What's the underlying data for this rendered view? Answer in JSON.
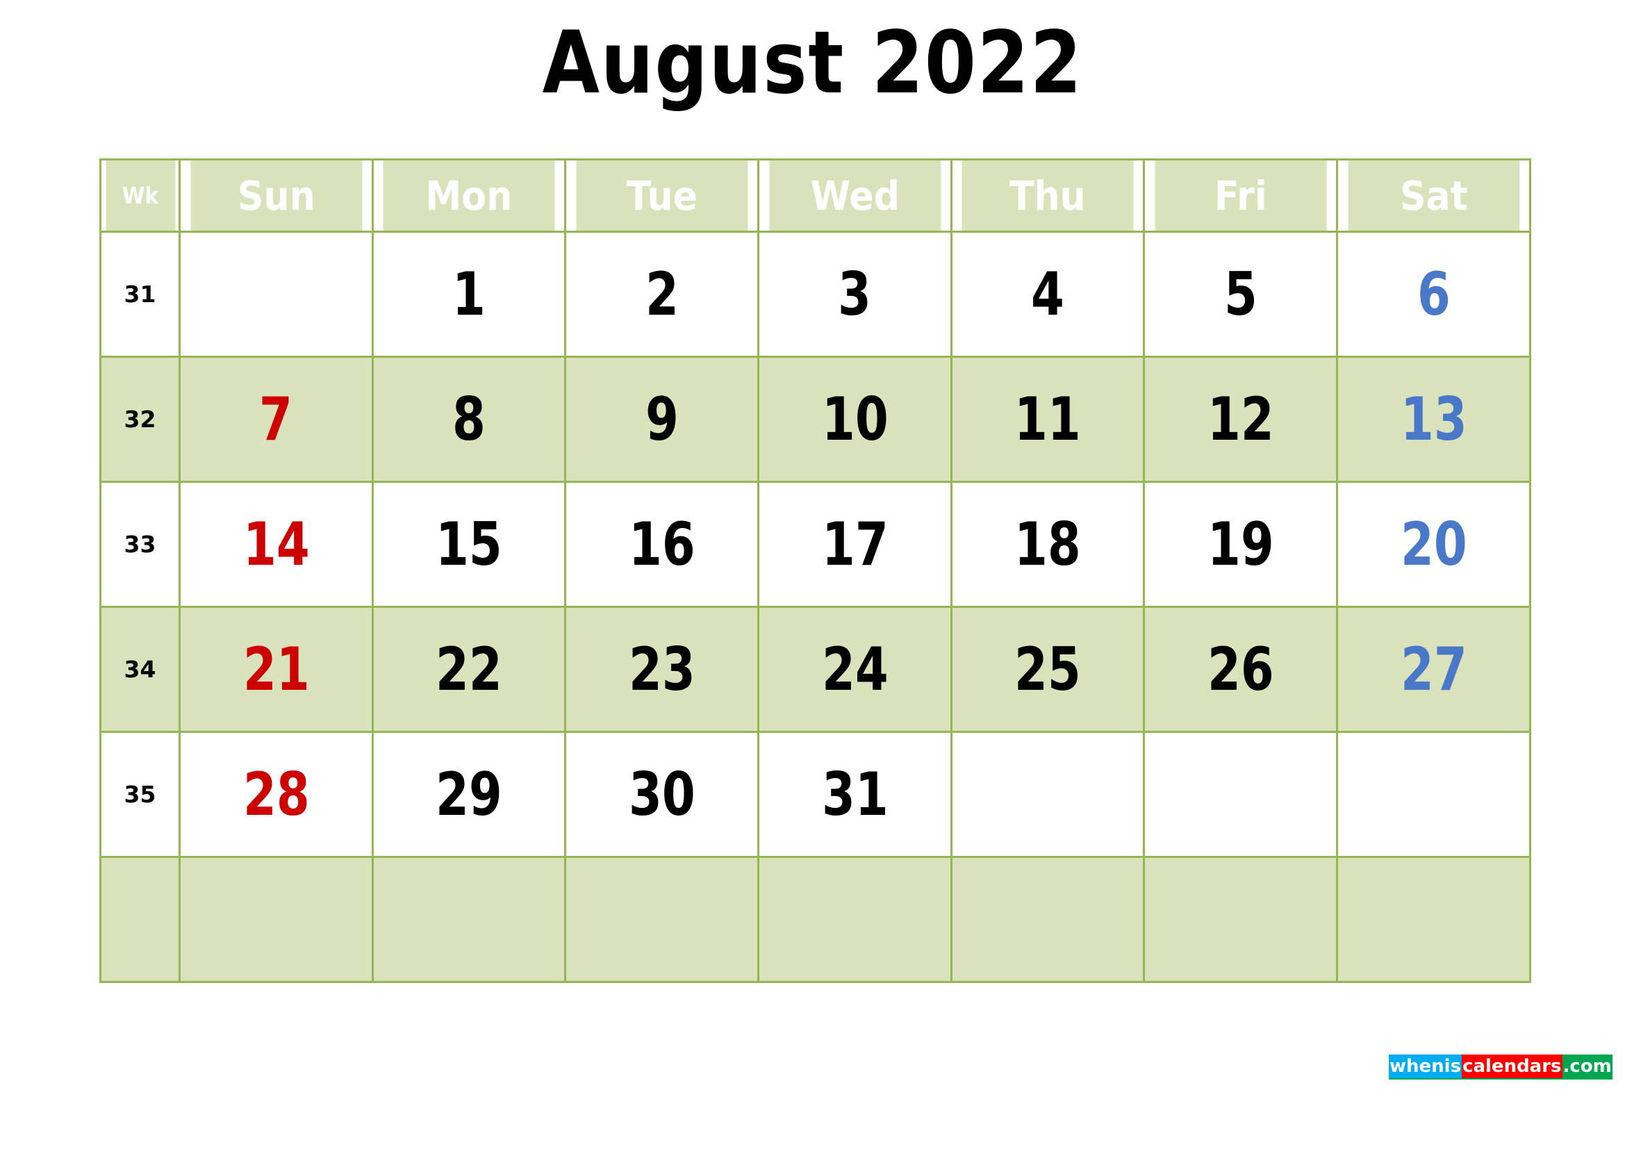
{
  "title": "August 2022",
  "colors": {
    "header_bg": "#d9e2bb",
    "shaded_row_bg": "#d9e2bb",
    "grid_line": "#95b654",
    "sunday_text": "#cc0000",
    "saturday_text": "#4a78c8",
    "weekday_text": "#000000",
    "header_text": "#ffffff"
  },
  "table": {
    "headers": {
      "week": "Wk",
      "days": [
        "Sun",
        "Mon",
        "Tue",
        "Wed",
        "Thu",
        "Fri",
        "Sat"
      ]
    },
    "rows": [
      {
        "week": "31",
        "shaded": false,
        "days": [
          "",
          "1",
          "2",
          "3",
          "4",
          "5",
          "6"
        ]
      },
      {
        "week": "32",
        "shaded": true,
        "days": [
          "7",
          "8",
          "9",
          "10",
          "11",
          "12",
          "13"
        ]
      },
      {
        "week": "33",
        "shaded": false,
        "days": [
          "14",
          "15",
          "16",
          "17",
          "18",
          "19",
          "20"
        ]
      },
      {
        "week": "34",
        "shaded": true,
        "days": [
          "21",
          "22",
          "23",
          "24",
          "25",
          "26",
          "27"
        ]
      },
      {
        "week": "35",
        "shaded": false,
        "days": [
          "28",
          "29",
          "30",
          "31",
          "",
          "",
          ""
        ]
      },
      {
        "week": "",
        "shaded": true,
        "days": [
          "",
          "",
          "",
          "",
          "",
          "",
          ""
        ]
      }
    ]
  },
  "logo": {
    "part1": "whenis",
    "part2": "calendars",
    "part3": ".com"
  }
}
